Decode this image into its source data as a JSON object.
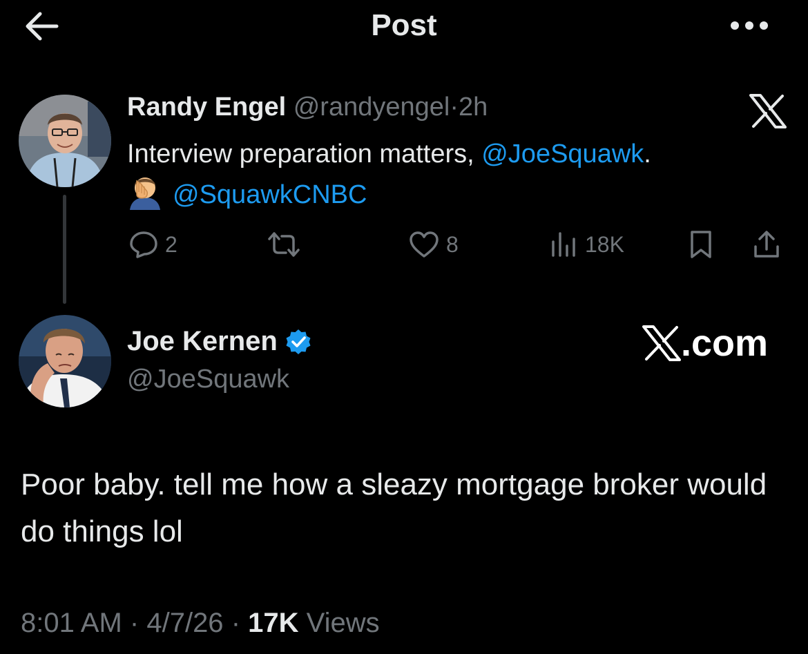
{
  "header": {
    "title": "Post"
  },
  "parent_tweet": {
    "display_name": "Randy Engel",
    "handle": "@randyengel",
    "separator": "·",
    "time": "2h",
    "text_main": "Interview preparation matters, ",
    "mention_1": "@JoeSquawk",
    "text_period": ".",
    "emoji": "facepalm-emoji",
    "mention_2": "@SquawkCNBC",
    "actions": {
      "replies": "2",
      "likes": "8",
      "views": "18K"
    }
  },
  "main_tweet": {
    "display_name": "Joe Kernen",
    "verified": true,
    "handle": "@JoeSquawk",
    "text": "Poor baby. tell me how a sleazy mortgage broker would do things lol",
    "watermark": "X.com",
    "time": "8:01 AM",
    "date": "4/7/26",
    "views_count": "17K",
    "views_label": "Views",
    "separator": "·"
  },
  "colors": {
    "background": "#000000",
    "text": "#e7e9ea",
    "muted": "#71767b",
    "link": "#1d9bf0"
  }
}
